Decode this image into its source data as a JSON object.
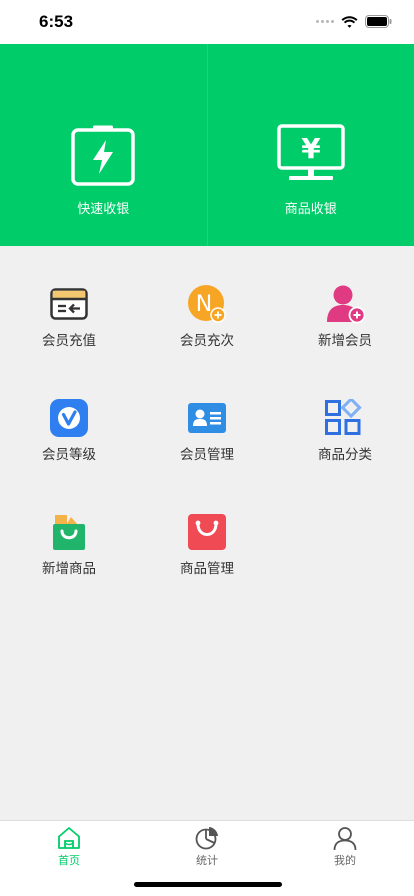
{
  "status_bar": {
    "time": "6:53"
  },
  "header": {
    "quick_checkout_label": "快速收银",
    "goods_checkout_label": "商品收银",
    "goods_checkout_icon_glyph": "¥",
    "bg_color": "#00cc6a"
  },
  "grid": {
    "items": [
      {
        "label": "会员充值",
        "icon": "card-recharge-icon"
      },
      {
        "label": "会员充次",
        "icon": "count-recharge-icon",
        "glyph": "N"
      },
      {
        "label": "新增会员",
        "icon": "add-member-icon"
      },
      {
        "label": "会员等级",
        "icon": "member-level-icon"
      },
      {
        "label": "会员管理",
        "icon": "member-card-icon"
      },
      {
        "label": "商品分类",
        "icon": "category-icon"
      },
      {
        "label": "新增商品",
        "icon": "add-goods-icon"
      },
      {
        "label": "商品管理",
        "icon": "goods-manage-icon"
      }
    ]
  },
  "tab_bar": {
    "tabs": [
      {
        "label": "首页",
        "icon": "home-icon",
        "active": true
      },
      {
        "label": "统计",
        "icon": "statistics-icon",
        "active": false
      },
      {
        "label": "我的",
        "icon": "profile-icon",
        "active": false
      }
    ],
    "active_color": "#00cc6a"
  }
}
